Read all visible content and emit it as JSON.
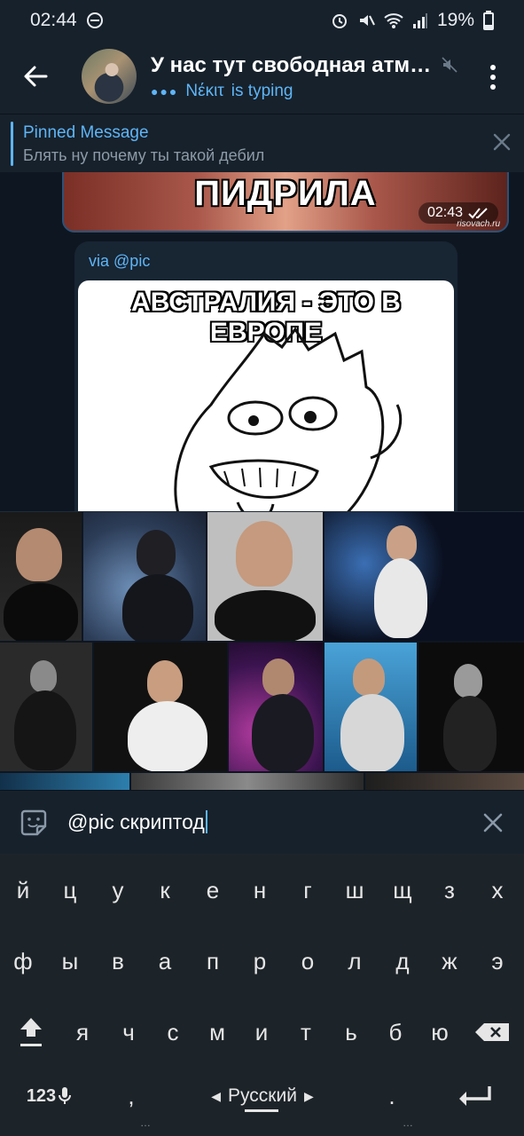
{
  "status_bar": {
    "time": "02:44",
    "battery": "19%"
  },
  "header": {
    "title": "У нас тут свободная атм…",
    "typing_user": "Nέκιτ",
    "typing_suffix": "is typing"
  },
  "pinned": {
    "title": "Pinned Message",
    "text": "Блять ну почему ты такой дебил"
  },
  "messages": [
    {
      "caption": "ПИДРИЛА",
      "time": "02:43",
      "watermark": "risovach.ru"
    },
    {
      "via_prefix": "via",
      "via_bot": "@pic",
      "caption_line1": "АВСТРАЛИЯ - ЭТО В",
      "caption_line2": "ЕВРОПЕ"
    }
  ],
  "input": {
    "value": "@pic скриптод"
  },
  "keyboard": {
    "row1": [
      "й",
      "ц",
      "у",
      "к",
      "е",
      "н",
      "г",
      "ш",
      "щ",
      "з",
      "х"
    ],
    "row2": [
      "ф",
      "ы",
      "в",
      "а",
      "п",
      "р",
      "о",
      "л",
      "д",
      "ж",
      "э"
    ],
    "row3": [
      "я",
      "ч",
      "с",
      "м",
      "и",
      "т",
      "ь",
      "б",
      "ю"
    ],
    "numbers_key": "123",
    "comma": ",",
    "period": ".",
    "language": "Русский"
  },
  "colors": {
    "accent": "#5eb5f7",
    "header_bg": "#17212b",
    "chat_bg": "#0e1621",
    "keyboard_bg": "#1d2429"
  }
}
